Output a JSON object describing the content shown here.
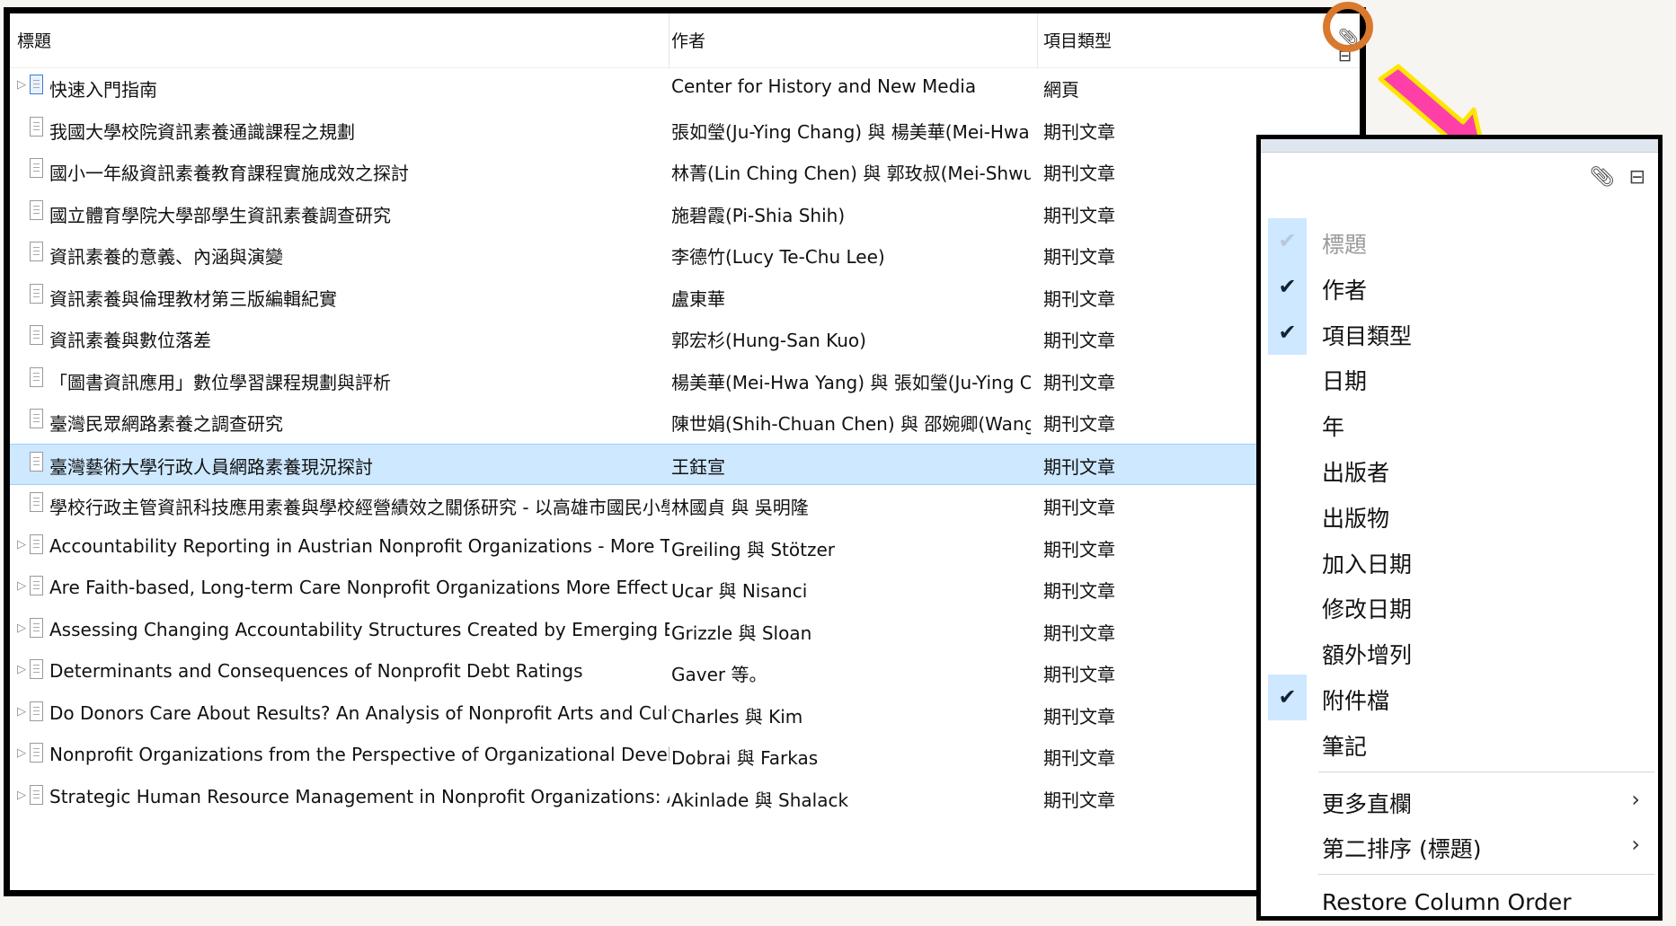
{
  "columns": {
    "title": "標題",
    "author": "作者",
    "type": "項目類型"
  },
  "header_icons": [
    "paperclip-icon",
    "column-picker-icon"
  ],
  "items": [
    {
      "title": "快速入門指南",
      "author": "Center for History and New Media",
      "type": "網頁",
      "icon": "web-page-icon",
      "expandable": true,
      "selected": false
    },
    {
      "title": "我國大學校院資訊素養通識課程之規劃",
      "author": "張如瑩(Ju-Ying Chang) 與 楊美華(Mei-Hwa Yang)",
      "type": "期刊文章",
      "icon": "journal-article-icon",
      "expandable": false,
      "selected": false
    },
    {
      "title": "國小一年級資訊素養教育課程實施成效之探討",
      "author": "林菁(Lin Ching Chen) 與 郭玫叔(Mei-Shwu Kuo)",
      "type": "期刊文章",
      "icon": "journal-article-icon",
      "expandable": false,
      "selected": false
    },
    {
      "title": "國立體育學院大學部學生資訊素養調查研究",
      "author": "施碧霞(Pi-Shia Shih)",
      "type": "期刊文章",
      "icon": "journal-article-icon",
      "expandable": false,
      "selected": false
    },
    {
      "title": "資訊素養的意義、內涵與演變",
      "author": "李德竹(Lucy Te-Chu Lee)",
      "type": "期刊文章",
      "icon": "journal-article-icon",
      "expandable": false,
      "selected": false
    },
    {
      "title": "資訊素養與倫理教材第三版編輯紀實",
      "author": "盧東華",
      "type": "期刊文章",
      "icon": "journal-article-icon",
      "expandable": false,
      "selected": false
    },
    {
      "title": "資訊素養與數位落差",
      "author": "郭宏杉(Hung-San Kuo)",
      "type": "期刊文章",
      "icon": "journal-article-icon",
      "expandable": false,
      "selected": false
    },
    {
      "title": "「圖書資訊應用」數位學習課程規劃與評析",
      "author": "楊美華(Mei-Hwa Yang) 與 張如瑩(Ju-Ying Chang)",
      "type": "期刊文章",
      "icon": "journal-article-icon",
      "expandable": false,
      "selected": false
    },
    {
      "title": "臺灣民眾網路素養之調查研究",
      "author": "陳世娟(Shih-Chuan Chen) 與 邵婉卿(Wang-Ching Shaw)",
      "type": "期刊文章",
      "icon": "journal-article-icon",
      "expandable": false,
      "selected": false
    },
    {
      "title": "臺灣藝術大學行政人員網路素養現況探討",
      "author": "王鈺宣",
      "type": "期刊文章",
      "icon": "journal-article-icon",
      "expandable": false,
      "selected": true
    },
    {
      "title": "學校行政主管資訊科技應用素養與學校經營績效之關係研究 - 以高雄市國民小學為例",
      "author": "林國貞 與 吳明隆",
      "type": "期刊文章",
      "icon": "journal-article-icon",
      "expandable": false,
      "selected": false
    },
    {
      "title": "Accountability Reporting in Austrian Nonprofit Organizations - More Than a Compliance Instrument?",
      "author": "Greiling 與 Stötzer",
      "type": "期刊文章",
      "icon": "journal-article-icon",
      "expandable": true,
      "selected": false
    },
    {
      "title": "Are Faith-based, Long-term Care Nonprofit Organizations More Effective? A Survey Study of Nursing Ho...",
      "author": "Ucar 與 Nisanci",
      "type": "期刊文章",
      "icon": "journal-article-icon",
      "expandable": true,
      "selected": false
    },
    {
      "title": "Assessing Changing Accountability Structures Created by Emerging Equity Markets in the Nonprofit Sector",
      "author": "Grizzle 與 Sloan",
      "type": "期刊文章",
      "icon": "journal-article-icon",
      "expandable": true,
      "selected": false
    },
    {
      "title": "Determinants and Consequences of Nonprofit Debt Ratings",
      "author": "Gaver 等。",
      "type": "期刊文章",
      "icon": "journal-article-icon",
      "expandable": true,
      "selected": false
    },
    {
      "title": "Do Donors Care About Results? An Analysis of Nonprofit Arts and Cultural Organizations",
      "author": "Charles 與 Kim",
      "type": "期刊文章",
      "icon": "journal-article-icon",
      "expandable": true,
      "selected": false
    },
    {
      "title": "Nonprofit Organizations from the Perspective of Organizational Development and Their Influence on Pr...",
      "author": "Dobrai 與 Farkas",
      "type": "期刊文章",
      "icon": "journal-article-icon",
      "expandable": true,
      "selected": false
    },
    {
      "title": "Strategic Human Resource Management in Nonprofit Organizations: A Case for Mission-Driven Human ...",
      "author": "Akinlade 與 Shalack",
      "type": "期刊文章",
      "icon": "journal-article-icon",
      "expandable": true,
      "selected": false
    }
  ],
  "menu": {
    "icons": [
      "paperclip-icon",
      "column-picker-icon"
    ],
    "items": [
      {
        "label": "標題",
        "checked": true,
        "disabled": true,
        "submenu": false
      },
      {
        "label": "作者",
        "checked": true,
        "disabled": false,
        "submenu": false
      },
      {
        "label": "項目類型",
        "checked": true,
        "disabled": false,
        "submenu": false
      },
      {
        "label": "日期",
        "checked": false,
        "disabled": false,
        "submenu": false
      },
      {
        "label": "年",
        "checked": false,
        "disabled": false,
        "submenu": false
      },
      {
        "label": "出版者",
        "checked": false,
        "disabled": false,
        "submenu": false
      },
      {
        "label": "出版物",
        "checked": false,
        "disabled": false,
        "submenu": false
      },
      {
        "label": "加入日期",
        "checked": false,
        "disabled": false,
        "submenu": false
      },
      {
        "label": "修改日期",
        "checked": false,
        "disabled": false,
        "submenu": false
      },
      {
        "label": "額外增列",
        "checked": false,
        "disabled": false,
        "submenu": false
      },
      {
        "label": "附件檔",
        "checked": true,
        "disabled": false,
        "submenu": false
      },
      {
        "label": "筆記",
        "checked": false,
        "disabled": false,
        "submenu": false
      },
      {
        "label": "更多直欄",
        "checked": false,
        "disabled": false,
        "submenu": true,
        "separator_before": true
      },
      {
        "label": "第二排序 (標題)",
        "checked": false,
        "disabled": false,
        "submenu": true
      },
      {
        "label": "Restore Column Order",
        "checked": false,
        "disabled": false,
        "submenu": false,
        "separator_before": true
      }
    ]
  },
  "colors": {
    "selection": "#cde8ff",
    "highlight_circle": "#d9792d",
    "arrow_fill": "#ff3fa8",
    "arrow_outline": "#ffe600"
  }
}
